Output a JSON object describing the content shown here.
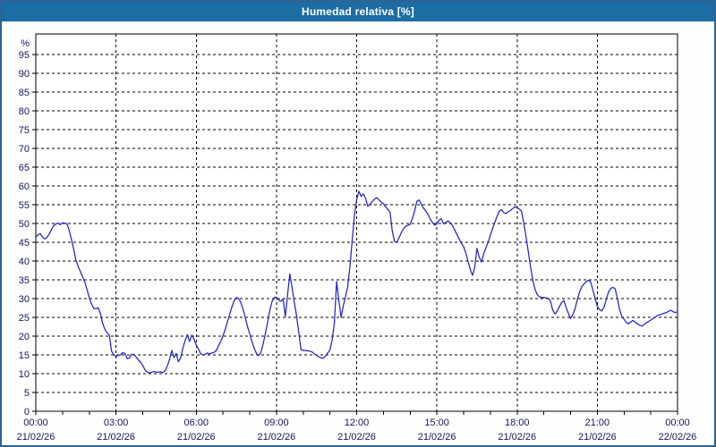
{
  "title": "Humedad relativa [%]",
  "colors": {
    "title_bar": "#1c6da4",
    "title_text": "#ffffff",
    "page_border": "#2e6293",
    "page_bg": "#fdfefd",
    "plot_bg": "#ffffff",
    "axis": "#000000",
    "grid": "#000000",
    "label": "#16165e",
    "line": "#2323cb"
  },
  "chart_data": {
    "type": "line",
    "title": "Humedad relativa [%]",
    "ylabel": "%",
    "ylim": [
      0,
      100.5
    ],
    "y_ticks": [
      0,
      5,
      10,
      15,
      20,
      25,
      30,
      35,
      40,
      45,
      50,
      55,
      60,
      65,
      70,
      75,
      80,
      85,
      90,
      95
    ],
    "grid": "dashed",
    "legend": "none",
    "x_range_minutes": [
      0,
      1440
    ],
    "x_minor_tick_every_minutes": 60,
    "x_major_ticks": [
      {
        "minute": 0,
        "time": "00:00",
        "date": "21/02/26"
      },
      {
        "minute": 180,
        "time": "03:00",
        "date": "21/02/26"
      },
      {
        "minute": 360,
        "time": "06:00",
        "date": "21/02/26"
      },
      {
        "minute": 540,
        "time": "09:00",
        "date": "21/02/26"
      },
      {
        "minute": 720,
        "time": "12:00",
        "date": "21/02/26"
      },
      {
        "minute": 900,
        "time": "15:00",
        "date": "21/02/26"
      },
      {
        "minute": 1080,
        "time": "18:00",
        "date": "21/02/26"
      },
      {
        "minute": 1260,
        "time": "21:00",
        "date": "21/02/26"
      },
      {
        "minute": 1440,
        "time": "00:00",
        "date": "22/02/26"
      }
    ],
    "series": [
      {
        "name": "Humedad relativa [%]",
        "color": "#2323cb",
        "points": [
          [
            0,
            46.4
          ],
          [
            5,
            47.0
          ],
          [
            10,
            47.3
          ],
          [
            15,
            46.4
          ],
          [
            20,
            45.9
          ],
          [
            25,
            46.3
          ],
          [
            30,
            47.2
          ],
          [
            35,
            48.4
          ],
          [
            40,
            49.4
          ],
          [
            45,
            49.9
          ],
          [
            50,
            50.1
          ],
          [
            55,
            49.7
          ],
          [
            60,
            50.2
          ],
          [
            65,
            50.1
          ],
          [
            70,
            49.9
          ],
          [
            75,
            48.2
          ],
          [
            80,
            45.8
          ],
          [
            85,
            43.2
          ],
          [
            90,
            40.3
          ],
          [
            95,
            38.6
          ],
          [
            100,
            37.2
          ],
          [
            105,
            35.8
          ],
          [
            110,
            34.4
          ],
          [
            115,
            32.4
          ],
          [
            120,
            30.2
          ],
          [
            125,
            28.6
          ],
          [
            130,
            27.4
          ],
          [
            135,
            27.3
          ],
          [
            140,
            27.6
          ],
          [
            145,
            26.0
          ],
          [
            150,
            23.4
          ],
          [
            155,
            21.8
          ],
          [
            160,
            20.9
          ],
          [
            165,
            20.3
          ],
          [
            170,
            16.0
          ],
          [
            175,
            15.1
          ],
          [
            180,
            14.5
          ],
          [
            185,
            14.9
          ],
          [
            190,
            15.0
          ],
          [
            195,
            15.6
          ],
          [
            200,
            15.4
          ],
          [
            205,
            14.0
          ],
          [
            210,
            14.2
          ],
          [
            215,
            15.2
          ],
          [
            220,
            15.1
          ],
          [
            225,
            14.5
          ],
          [
            230,
            13.7
          ],
          [
            235,
            13.1
          ],
          [
            240,
            12.2
          ],
          [
            245,
            11.0
          ],
          [
            250,
            10.4
          ],
          [
            255,
            10.2
          ],
          [
            260,
            10.4
          ],
          [
            265,
            10.6
          ],
          [
            270,
            10.4
          ],
          [
            275,
            10.4
          ],
          [
            280,
            10.5
          ],
          [
            285,
            10.3
          ],
          [
            290,
            10.8
          ],
          [
            295,
            12.0
          ],
          [
            300,
            13.8
          ],
          [
            305,
            16.2
          ],
          [
            310,
            14.3
          ],
          [
            315,
            15.4
          ],
          [
            320,
            13.2
          ],
          [
            325,
            14.2
          ],
          [
            330,
            16.8
          ],
          [
            335,
            18.8
          ],
          [
            340,
            20.4
          ],
          [
            345,
            18.6
          ],
          [
            350,
            20.3
          ],
          [
            355,
            19.2
          ],
          [
            360,
            17.6
          ],
          [
            365,
            16.6
          ],
          [
            370,
            15.3
          ],
          [
            375,
            15.0
          ],
          [
            380,
            15.2
          ],
          [
            385,
            15.5
          ],
          [
            390,
            15.3
          ],
          [
            395,
            15.5
          ],
          [
            400,
            15.7
          ],
          [
            405,
            16.2
          ],
          [
            410,
            17.4
          ],
          [
            415,
            18.6
          ],
          [
            420,
            20.0
          ],
          [
            425,
            21.8
          ],
          [
            430,
            23.8
          ],
          [
            435,
            25.8
          ],
          [
            440,
            27.8
          ],
          [
            445,
            29.4
          ],
          [
            450,
            30.3
          ],
          [
            455,
            30.0
          ],
          [
            460,
            29.0
          ],
          [
            465,
            27.2
          ],
          [
            470,
            25.0
          ],
          [
            475,
            22.6
          ],
          [
            480,
            20.6
          ],
          [
            485,
            18.6
          ],
          [
            490,
            16.8
          ],
          [
            495,
            15.4
          ],
          [
            500,
            14.8
          ],
          [
            505,
            15.6
          ],
          [
            510,
            17.8
          ],
          [
            515,
            20.6
          ],
          [
            520,
            23.6
          ],
          [
            525,
            26.8
          ],
          [
            530,
            29.2
          ],
          [
            535,
            30.3
          ],
          [
            540,
            30.4
          ],
          [
            545,
            29.6
          ],
          [
            550,
            29.3
          ],
          [
            555,
            29.9
          ],
          [
            560,
            25.2
          ],
          [
            565,
            31.0
          ],
          [
            570,
            36.6
          ],
          [
            575,
            33.0
          ],
          [
            580,
            29.0
          ],
          [
            585,
            25.5
          ],
          [
            590,
            21.0
          ],
          [
            595,
            16.4
          ],
          [
            600,
            16.2
          ],
          [
            605,
            16.2
          ],
          [
            610,
            16.1
          ],
          [
            615,
            16.0
          ],
          [
            620,
            15.8
          ],
          [
            625,
            15.3
          ],
          [
            630,
            14.9
          ],
          [
            635,
            14.5
          ],
          [
            640,
            14.2
          ],
          [
            645,
            14.1
          ],
          [
            650,
            14.7
          ],
          [
            655,
            15.5
          ],
          [
            660,
            16.3
          ],
          [
            665,
            19.0
          ],
          [
            670,
            23.5
          ],
          [
            675,
            34.6
          ],
          [
            680,
            29.5
          ],
          [
            685,
            25.0
          ],
          [
            690,
            28.2
          ],
          [
            695,
            30.6
          ],
          [
            700,
            33.2
          ],
          [
            705,
            38.5
          ],
          [
            710,
            45.5
          ],
          [
            715,
            52.0
          ],
          [
            720,
            56.4
          ],
          [
            725,
            58.6
          ],
          [
            730,
            57.2
          ],
          [
            735,
            57.9
          ],
          [
            740,
            56.7
          ],
          [
            745,
            54.6
          ],
          [
            750,
            55.1
          ],
          [
            755,
            55.9
          ],
          [
            760,
            56.5
          ],
          [
            765,
            56.9
          ],
          [
            770,
            56.3
          ],
          [
            775,
            55.7
          ],
          [
            780,
            55.3
          ],
          [
            785,
            54.4
          ],
          [
            790,
            53.8
          ],
          [
            795,
            53.0
          ],
          [
            800,
            48.0
          ],
          [
            805,
            45.2
          ],
          [
            810,
            45.0
          ],
          [
            815,
            46.2
          ],
          [
            820,
            47.5
          ],
          [
            825,
            48.6
          ],
          [
            830,
            49.3
          ],
          [
            835,
            49.5
          ],
          [
            840,
            49.8
          ],
          [
            845,
            51.3
          ],
          [
            850,
            53.3
          ],
          [
            855,
            55.9
          ],
          [
            860,
            56.3
          ],
          [
            865,
            55.1
          ],
          [
            870,
            54.1
          ],
          [
            875,
            53.4
          ],
          [
            880,
            52.4
          ],
          [
            885,
            51.2
          ],
          [
            890,
            50.3
          ],
          [
            895,
            49.6
          ],
          [
            900,
            49.9
          ],
          [
            905,
            50.9
          ],
          [
            910,
            51.3
          ],
          [
            915,
            49.9
          ],
          [
            920,
            50.3
          ],
          [
            925,
            50.7
          ],
          [
            930,
            50.2
          ],
          [
            935,
            49.4
          ],
          [
            940,
            48.3
          ],
          [
            945,
            47.1
          ],
          [
            950,
            45.9
          ],
          [
            955,
            44.7
          ],
          [
            960,
            43.9
          ],
          [
            965,
            42.1
          ],
          [
            970,
            39.9
          ],
          [
            975,
            37.7
          ],
          [
            980,
            36.2
          ],
          [
            985,
            38.3
          ],
          [
            990,
            43.4
          ],
          [
            995,
            41.1
          ],
          [
            1000,
            39.7
          ],
          [
            1005,
            41.9
          ],
          [
            1010,
            43.5
          ],
          [
            1015,
            45.1
          ],
          [
            1020,
            46.9
          ],
          [
            1025,
            48.7
          ],
          [
            1030,
            50.3
          ],
          [
            1035,
            51.9
          ],
          [
            1040,
            53.3
          ],
          [
            1045,
            53.7
          ],
          [
            1050,
            52.9
          ],
          [
            1055,
            52.7
          ],
          [
            1060,
            53.1
          ],
          [
            1065,
            53.5
          ],
          [
            1070,
            54.0
          ],
          [
            1075,
            54.5
          ],
          [
            1080,
            54.1
          ],
          [
            1085,
            53.9
          ],
          [
            1090,
            53.3
          ],
          [
            1095,
            50.1
          ],
          [
            1100,
            46.6
          ],
          [
            1105,
            42.6
          ],
          [
            1110,
            38.6
          ],
          [
            1115,
            35.1
          ],
          [
            1120,
            32.5
          ],
          [
            1125,
            31.1
          ],
          [
            1130,
            30.5
          ],
          [
            1135,
            30.3
          ],
          [
            1140,
            30.3
          ],
          [
            1145,
            30.2
          ],
          [
            1150,
            30.1
          ],
          [
            1155,
            29.3
          ],
          [
            1160,
            26.9
          ],
          [
            1165,
            25.9
          ],
          [
            1170,
            26.7
          ],
          [
            1175,
            27.9
          ],
          [
            1180,
            28.9
          ],
          [
            1185,
            29.5
          ],
          [
            1190,
            27.7
          ],
          [
            1195,
            26.1
          ],
          [
            1200,
            24.7
          ],
          [
            1205,
            25.7
          ],
          [
            1210,
            27.3
          ],
          [
            1215,
            29.7
          ],
          [
            1220,
            31.7
          ],
          [
            1225,
            33.1
          ],
          [
            1230,
            33.9
          ],
          [
            1235,
            34.5
          ],
          [
            1240,
            34.9
          ],
          [
            1245,
            34.5
          ],
          [
            1250,
            32.3
          ],
          [
            1255,
            30.1
          ],
          [
            1260,
            27.9
          ],
          [
            1265,
            27.1
          ],
          [
            1270,
            26.7
          ],
          [
            1275,
            27.7
          ],
          [
            1280,
            29.7
          ],
          [
            1285,
            31.7
          ],
          [
            1290,
            32.7
          ],
          [
            1295,
            33.0
          ],
          [
            1300,
            32.6
          ],
          [
            1305,
            30.1
          ],
          [
            1310,
            27.1
          ],
          [
            1315,
            25.3
          ],
          [
            1320,
            24.5
          ],
          [
            1325,
            23.7
          ],
          [
            1330,
            23.3
          ],
          [
            1335,
            23.8
          ],
          [
            1340,
            24.2
          ],
          [
            1345,
            23.7
          ],
          [
            1350,
            23.3
          ],
          [
            1355,
            22.9
          ],
          [
            1360,
            22.7
          ],
          [
            1365,
            23.1
          ],
          [
            1370,
            23.5
          ],
          [
            1375,
            23.9
          ],
          [
            1380,
            24.3
          ],
          [
            1385,
            24.7
          ],
          [
            1390,
            25.1
          ],
          [
            1395,
            25.5
          ],
          [
            1400,
            25.7
          ],
          [
            1405,
            25.9
          ],
          [
            1410,
            26.1
          ],
          [
            1415,
            26.3
          ],
          [
            1420,
            26.6
          ],
          [
            1425,
            26.9
          ],
          [
            1430,
            26.5
          ],
          [
            1435,
            26.3
          ],
          [
            1440,
            26.5
          ]
        ]
      }
    ]
  }
}
